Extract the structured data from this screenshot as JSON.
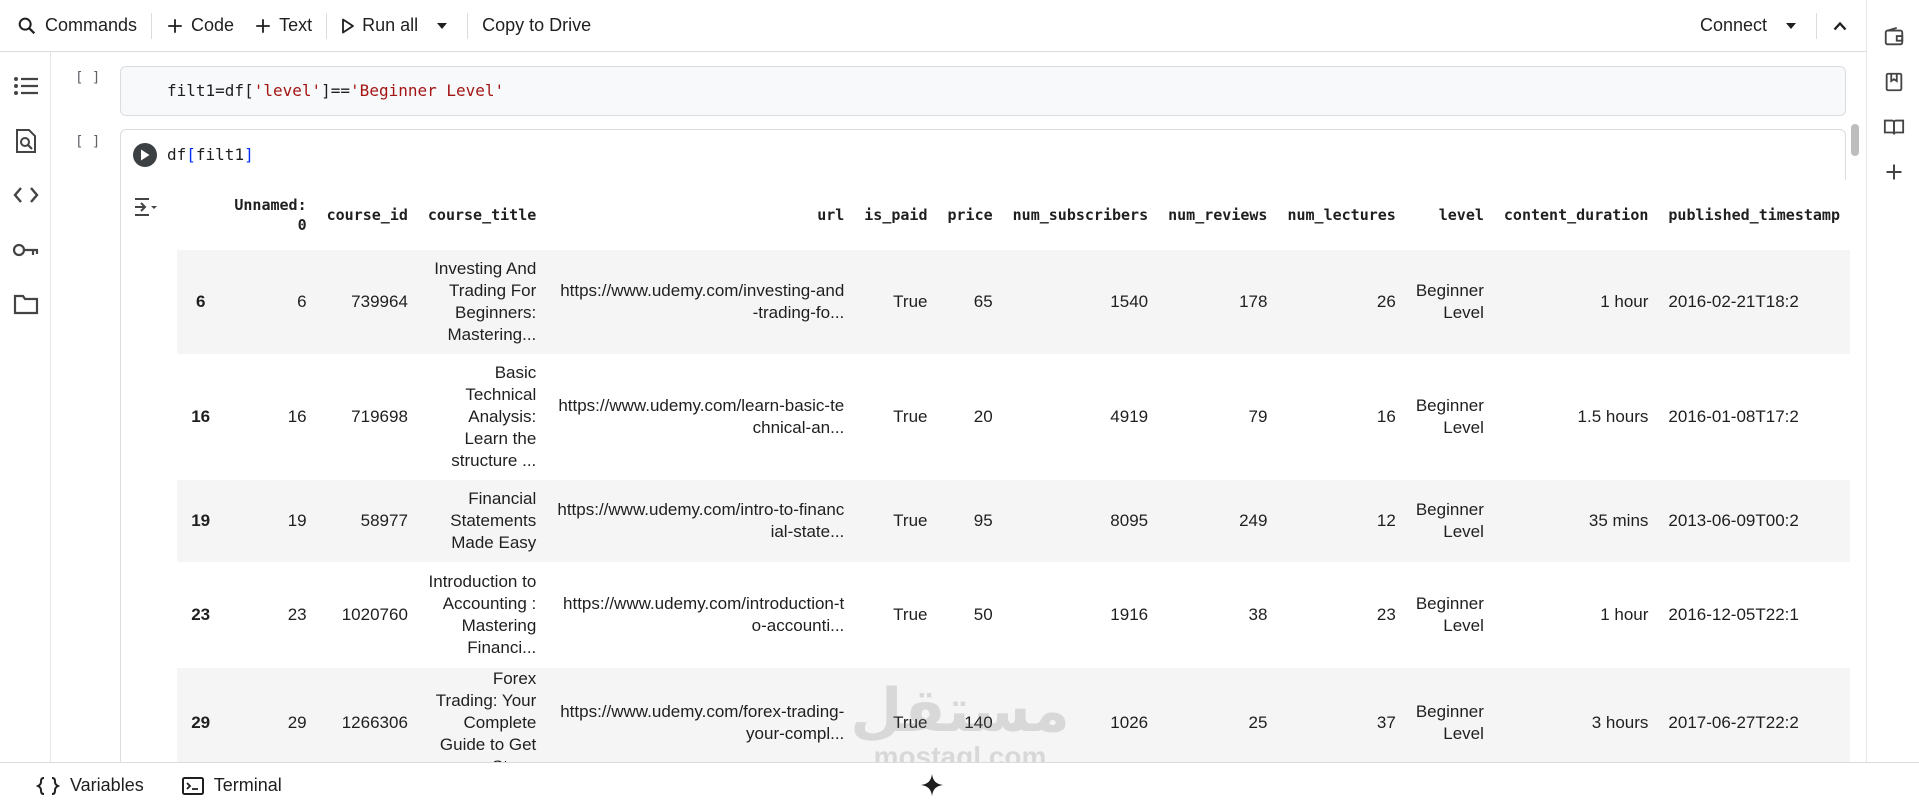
{
  "toolbar": {
    "commands": "Commands",
    "code": "Code",
    "text": "Text",
    "run_all": "Run all",
    "copy_to_drive": "Copy to Drive",
    "connect": "Connect"
  },
  "cells": [
    {
      "bracket": "[ ]",
      "tokens": {
        "a": "filt1=df[",
        "b": "'level'",
        "c": "]==",
        "d": "'Beginner Level'"
      }
    },
    {
      "bracket": "[ ]",
      "tokens": {
        "a": "df",
        "b": "[",
        "c": "filt1",
        "d": "]"
      }
    }
  ],
  "table": {
    "headers": [
      "",
      "Unnamed: 0",
      "course_id",
      "course_title",
      "url",
      "is_paid",
      "price",
      "num_subscribers",
      "num_reviews",
      "num_lectures",
      "level",
      "content_duration",
      "published_timestamp"
    ],
    "rows": [
      {
        "index": "6",
        "unnamed": "6",
        "course_id": "739964",
        "title": "Investing And Trading For Beginners: Mastering...",
        "url": "https://www.udemy.com/investing-and-trading-fo...",
        "is_paid": "True",
        "price": "65",
        "subs": "1540",
        "reviews": "178",
        "lectures": "26",
        "level": "Beginner Level",
        "duration": "1 hour",
        "published": "2016-02-21T18:2"
      },
      {
        "index": "16",
        "unnamed": "16",
        "course_id": "719698",
        "title": "Basic Technical Analysis: Learn the structure ...",
        "url": "https://www.udemy.com/learn-basic-technical-an...",
        "is_paid": "True",
        "price": "20",
        "subs": "4919",
        "reviews": "79",
        "lectures": "16",
        "level": "Beginner Level",
        "duration": "1.5 hours",
        "published": "2016-01-08T17:2"
      },
      {
        "index": "19",
        "unnamed": "19",
        "course_id": "58977",
        "title": "Financial Statements Made Easy",
        "url": "https://www.udemy.com/intro-to-financial-state...",
        "is_paid": "True",
        "price": "95",
        "subs": "8095",
        "reviews": "249",
        "lectures": "12",
        "level": "Beginner Level",
        "duration": "35 mins",
        "published": "2013-06-09T00:2"
      },
      {
        "index": "23",
        "unnamed": "23",
        "course_id": "1020760",
        "title": "Introduction to Accounting : Mastering Financi...",
        "url": "https://www.udemy.com/introduction-to-accounti...",
        "is_paid": "True",
        "price": "50",
        "subs": "1916",
        "reviews": "38",
        "lectures": "23",
        "level": "Beginner Level",
        "duration": "1 hour",
        "published": "2016-12-05T22:1"
      },
      {
        "index": "29",
        "unnamed": "29",
        "course_id": "1266306",
        "title": "Forex Trading: Your Complete Guide to Get Star...",
        "url": "https://www.udemy.com/forex-trading-your-compl...",
        "is_paid": "True",
        "price": "140",
        "subs": "1026",
        "reviews": "25",
        "lectures": "37",
        "level": "Beginner Level",
        "duration": "3 hours",
        "published": "2017-06-27T22:2"
      }
    ]
  },
  "bottom": {
    "variables": "Variables",
    "terminal": "Terminal"
  },
  "watermark": {
    "logo": "مستقل",
    "domain": "mostaql.com"
  }
}
